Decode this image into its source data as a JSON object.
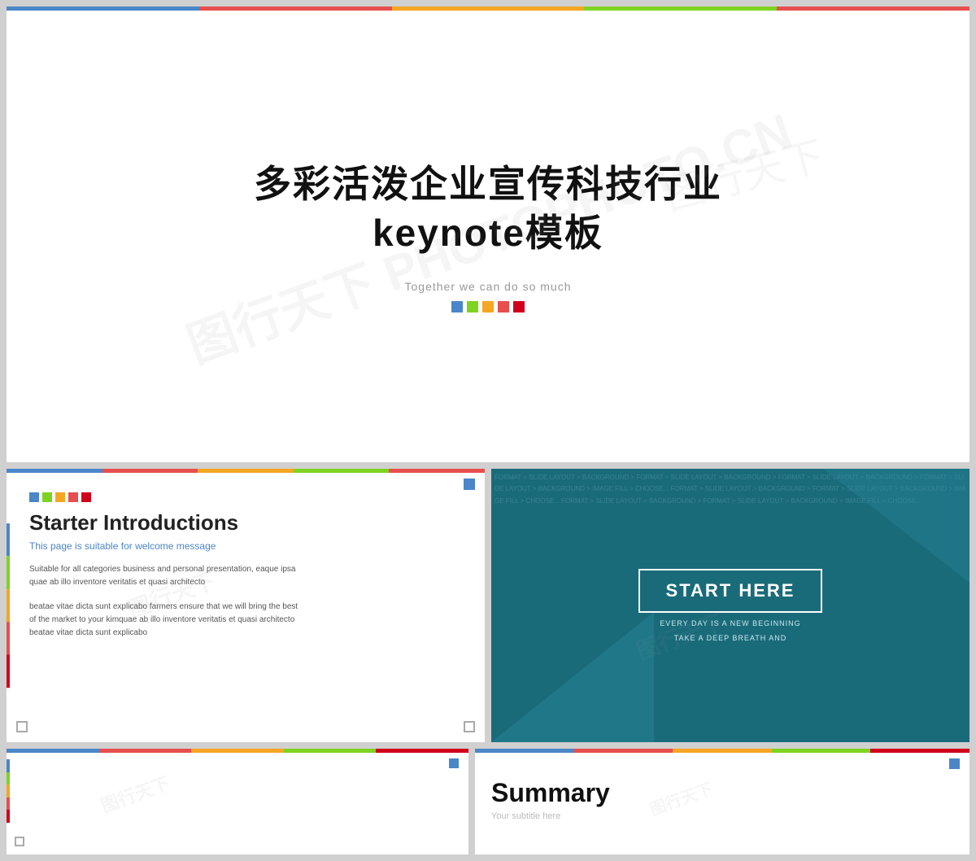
{
  "main_slide": {
    "title_zh": "多彩活泼企业宣传科技行业",
    "title_zh2": "keynote模板",
    "subtitle_en": "Together we can do so much",
    "color_dots": [
      "blue",
      "green",
      "orange",
      "red",
      "pink"
    ]
  },
  "intro_slide": {
    "title": "Starter Introductions",
    "subtitle": "This page is suitable for welcome message",
    "body1": "Suitable for all categories business and personal presentation, eaque ipsa quae ab illo inventore veritatis et quasi architecto",
    "body2": "beatae vitae dicta sunt explicabo farmers ensure that we will bring the best of the market to your kimquae ab illo inventore veritatis et quasi architecto beatae vitae dicta sunt explicabo"
  },
  "dark_slide": {
    "start_here": "START HERE",
    "line1": "EVERY DAY IS A NEW BEGINNING",
    "line2": "TAKE A DEEP BREATH AND",
    "bg_text": "FORMAT > SLIDE LAYOUT > BACKGROUND > FORMAT > SLIDE LAYOUT > BACKGROUND > FORMAT > SLIDE LAYOUT > BACKGROUND > FORMAT > SLIDE LAYOUT > BACKGROUND > IMAGE FILL > CHOOSE... FORMAT > SLIDE LAYOUT > BACKGROUND > FORMAT > SLIDE LAYOUT > BACKGROUND > IMAGE FILL > CHOOSE... FORMAT > SLIDE LAYOUT > BACKGROUND > FORMAT > SLIDE LAYOUT > BACKGROUND > IMAGE FILL > CHOOSE..."
  },
  "summary_slide": {
    "title": "Summary",
    "subtitle": "Your subtitle here"
  },
  "top_bar_colors": {
    "seg1": "#4a86c8",
    "seg2": "#e84e4e",
    "seg3": "#f5a623",
    "seg4": "#7ed321",
    "seg5": "#d0021b"
  }
}
